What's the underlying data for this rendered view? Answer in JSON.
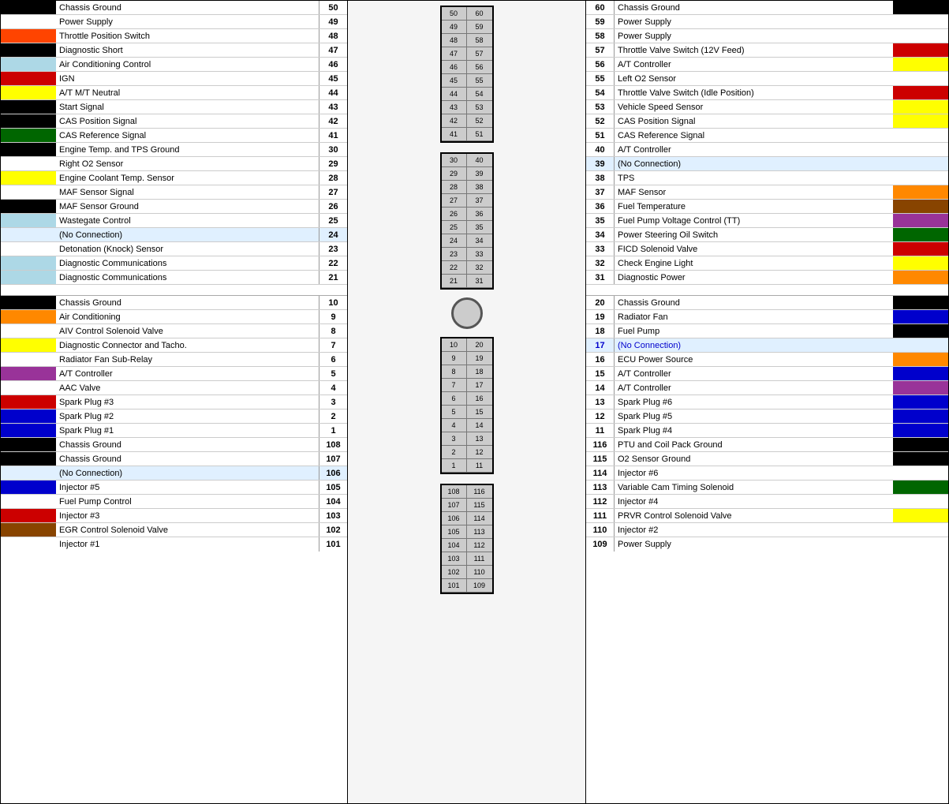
{
  "left_rows": [
    {
      "swatch": "#000000",
      "label": "Chassis Ground",
      "num": "50"
    },
    {
      "swatch": "",
      "label": "Power Supply",
      "num": "49"
    },
    {
      "swatch": "#ff4400",
      "label": "Throttle Position Switch",
      "num": "48"
    },
    {
      "swatch": "#000000",
      "label": "Diagnostic Short",
      "num": "47"
    },
    {
      "swatch": "#add8e6",
      "label": "Air Conditioning Control",
      "num": "46"
    },
    {
      "swatch": "#cc0000",
      "label": "IGN",
      "num": "45"
    },
    {
      "swatch": "#ffff00",
      "label": "A/T M/T Neutral",
      "num": "44"
    },
    {
      "swatch": "#000000",
      "label": "Start Signal",
      "num": "43"
    },
    {
      "swatch": "#000000",
      "label": "CAS Position Signal",
      "num": "42"
    },
    {
      "swatch": "#006600",
      "label": "CAS Reference Signal",
      "num": "41"
    },
    {
      "swatch": "#000000",
      "label": "Engine Temp. and TPS Ground",
      "num": "30"
    },
    {
      "swatch": "",
      "label": "Right O2 Sensor",
      "num": "29"
    },
    {
      "swatch": "#ffff00",
      "label": "Engine Coolant Temp. Sensor",
      "num": "28"
    },
    {
      "swatch": "",
      "label": "MAF Sensor Signal",
      "num": "27"
    },
    {
      "swatch": "#000000",
      "label": "MAF Sensor Ground",
      "num": "26"
    },
    {
      "swatch": "#add8e6",
      "label": "Wastegate Control",
      "num": "25"
    },
    {
      "swatch": "",
      "label": "(No Connection)",
      "num": "24",
      "no_conn": true
    },
    {
      "swatch": "",
      "label": "Detonation (Knock) Sensor",
      "num": "23"
    },
    {
      "swatch": "#add8e6",
      "label": "Diagnostic Communications",
      "num": "22"
    },
    {
      "swatch": "#add8e6",
      "label": "Diagnostic Communications",
      "num": "21"
    },
    {
      "swatch": "",
      "label": "",
      "num": "",
      "spacer": true
    },
    {
      "swatch": "#000000",
      "label": "Chassis Ground",
      "num": "10"
    },
    {
      "swatch": "#ff8800",
      "label": "Air Conditioning",
      "num": "9"
    },
    {
      "swatch": "",
      "label": "AIV Control Solenoid Valve",
      "num": "8"
    },
    {
      "swatch": "#ffff00",
      "label": "Diagnostic Connector and Tacho.",
      "num": "7"
    },
    {
      "swatch": "",
      "label": "Radiator Fan Sub-Relay",
      "num": "6"
    },
    {
      "swatch": "#993399",
      "label": "A/T Controller",
      "num": "5"
    },
    {
      "swatch": "",
      "label": "AAC Valve",
      "num": "4"
    },
    {
      "swatch": "#cc0000",
      "label": "Spark Plug #3",
      "num": "3"
    },
    {
      "swatch": "#0000cc",
      "label": "Spark Plug #2",
      "num": "2"
    },
    {
      "swatch": "#0000cc",
      "label": "Spark Plug #1",
      "num": "1"
    },
    {
      "swatch": "#000000",
      "label": "Chassis Ground",
      "num": "108"
    },
    {
      "swatch": "#000000",
      "label": "Chassis Ground",
      "num": "107"
    },
    {
      "swatch": "",
      "label": "(No Connection)",
      "num": "106",
      "no_conn": true
    },
    {
      "swatch": "#0000cc",
      "label": "Injector #5",
      "num": "105"
    },
    {
      "swatch": "",
      "label": "Fuel Pump Control",
      "num": "104"
    },
    {
      "swatch": "#cc0000",
      "label": "Injector #3",
      "num": "103"
    },
    {
      "swatch": "#884400",
      "label": "EGR Control Solenoid Valve",
      "num": "102"
    },
    {
      "swatch": "",
      "label": "Injector #1",
      "num": "101"
    }
  ],
  "right_rows": [
    {
      "num": "60",
      "label": "Chassis Ground",
      "swatch": "#000000"
    },
    {
      "num": "59",
      "label": "Power Supply",
      "swatch": ""
    },
    {
      "num": "58",
      "label": "Power Supply",
      "swatch": ""
    },
    {
      "num": "57",
      "label": "Throttle Valve Switch (12V Feed)",
      "swatch": "#cc0000"
    },
    {
      "num": "56",
      "label": "A/T Controller",
      "swatch": "#ffff00"
    },
    {
      "num": "55",
      "label": "Left O2 Sensor",
      "swatch": ""
    },
    {
      "num": "54",
      "label": "Throttle Valve Switch (Idle Position)",
      "swatch": "#cc0000"
    },
    {
      "num": "53",
      "label": "Vehicle Speed Sensor",
      "swatch": "#ffff00"
    },
    {
      "num": "52",
      "label": "CAS Position Signal",
      "swatch": "#ffff00"
    },
    {
      "num": "51",
      "label": "CAS Reference Signal",
      "swatch": ""
    },
    {
      "num": "40",
      "label": "A/T Controller",
      "swatch": ""
    },
    {
      "num": "39",
      "label": "(No Connection)",
      "swatch": "",
      "no_conn": true
    },
    {
      "num": "38",
      "label": "TPS",
      "swatch": ""
    },
    {
      "num": "37",
      "label": "MAF Sensor",
      "swatch": "#ff8800"
    },
    {
      "num": "36",
      "label": "Fuel Temperature",
      "swatch": "#884400"
    },
    {
      "num": "35",
      "label": "Fuel Pump Voltage Control (TT)",
      "swatch": "#993399"
    },
    {
      "num": "34",
      "label": "Power Steering Oil Switch",
      "swatch": "#006600"
    },
    {
      "num": "33",
      "label": "FICD Solenoid Valve",
      "swatch": "#cc0000"
    },
    {
      "num": "32",
      "label": "Check Engine Light",
      "swatch": "#ffff00"
    },
    {
      "num": "31",
      "label": "Diagnostic Power",
      "swatch": "#ff8800"
    },
    {
      "num": "",
      "label": "",
      "swatch": "",
      "spacer": true
    },
    {
      "num": "20",
      "label": "Chassis Ground",
      "swatch": "#000000"
    },
    {
      "num": "19",
      "label": "Radiator Fan",
      "swatch": "#0000cc"
    },
    {
      "num": "18",
      "label": "Fuel Pump",
      "swatch": "#000000"
    },
    {
      "num": "17",
      "label": "(No Connection)",
      "swatch": "",
      "no_conn": true
    },
    {
      "num": "16",
      "label": "ECU Power Source",
      "swatch": "#ff8800"
    },
    {
      "num": "15",
      "label": "A/T Controller",
      "swatch": "#0000cc"
    },
    {
      "num": "14",
      "label": "A/T Controller",
      "swatch": "#993399"
    },
    {
      "num": "13",
      "label": "Spark Plug #6",
      "swatch": "#0000cc"
    },
    {
      "num": "12",
      "label": "Spark Plug #5",
      "swatch": "#0000cc"
    },
    {
      "num": "11",
      "label": "Spark Plug #4",
      "swatch": "#0000cc"
    },
    {
      "num": "116",
      "label": "PTU and Coil Pack Ground",
      "swatch": "#000000"
    },
    {
      "num": "115",
      "label": "O2 Sensor Ground",
      "swatch": "#000000"
    },
    {
      "num": "114",
      "label": "Injector #6",
      "swatch": ""
    },
    {
      "num": "113",
      "label": "Variable Cam Timing Solenoid",
      "swatch": "#006600"
    },
    {
      "num": "112",
      "label": "Injector #4",
      "swatch": ""
    },
    {
      "num": "111",
      "label": "PRVR Control Solenoid Valve",
      "swatch": "#ffff00"
    },
    {
      "num": "110",
      "label": "Injector #2",
      "swatch": ""
    },
    {
      "num": "109",
      "label": "Power Supply",
      "swatch": ""
    }
  ],
  "connector": {
    "top_section": [
      {
        "left": "50",
        "right": "60"
      },
      {
        "left": "49",
        "right": "59"
      },
      {
        "left": "48",
        "right": "58"
      },
      {
        "left": "47",
        "right": "57"
      },
      {
        "left": "46",
        "right": "56"
      },
      {
        "left": "45",
        "right": "55"
      },
      {
        "left": "44",
        "right": "54"
      },
      {
        "left": "43",
        "right": "53"
      },
      {
        "left": "42",
        "right": "52"
      },
      {
        "left": "41",
        "right": "51"
      }
    ],
    "mid_section": [
      {
        "left": "30",
        "right": "40"
      },
      {
        "left": "29",
        "right": "39"
      },
      {
        "left": "28",
        "right": "38"
      },
      {
        "left": "27",
        "right": "37"
      },
      {
        "left": "26",
        "right": "36"
      },
      {
        "left": "25",
        "right": "35"
      },
      {
        "left": "24",
        "right": "34"
      },
      {
        "left": "23",
        "right": "33"
      },
      {
        "left": "22",
        "right": "32"
      },
      {
        "left": "21",
        "right": "31"
      }
    ],
    "lower_section": [
      {
        "left": "10",
        "right": "20"
      },
      {
        "left": "9",
        "right": "19"
      },
      {
        "left": "8",
        "right": "18"
      },
      {
        "left": "7",
        "right": "17"
      },
      {
        "left": "6",
        "right": "16"
      },
      {
        "left": "5",
        "right": "15"
      },
      {
        "left": "4",
        "right": "14"
      },
      {
        "left": "3",
        "right": "13"
      },
      {
        "left": "2",
        "right": "12"
      },
      {
        "left": "1",
        "right": "11"
      }
    ],
    "bottom_section": [
      {
        "left": "108",
        "right": "116"
      },
      {
        "left": "107",
        "right": "115"
      },
      {
        "left": "106",
        "right": "114"
      },
      {
        "left": "105",
        "right": "113"
      },
      {
        "left": "104",
        "right": "112"
      },
      {
        "left": "103",
        "right": "111"
      },
      {
        "left": "102",
        "right": "110"
      },
      {
        "left": "101",
        "right": "109"
      }
    ]
  }
}
